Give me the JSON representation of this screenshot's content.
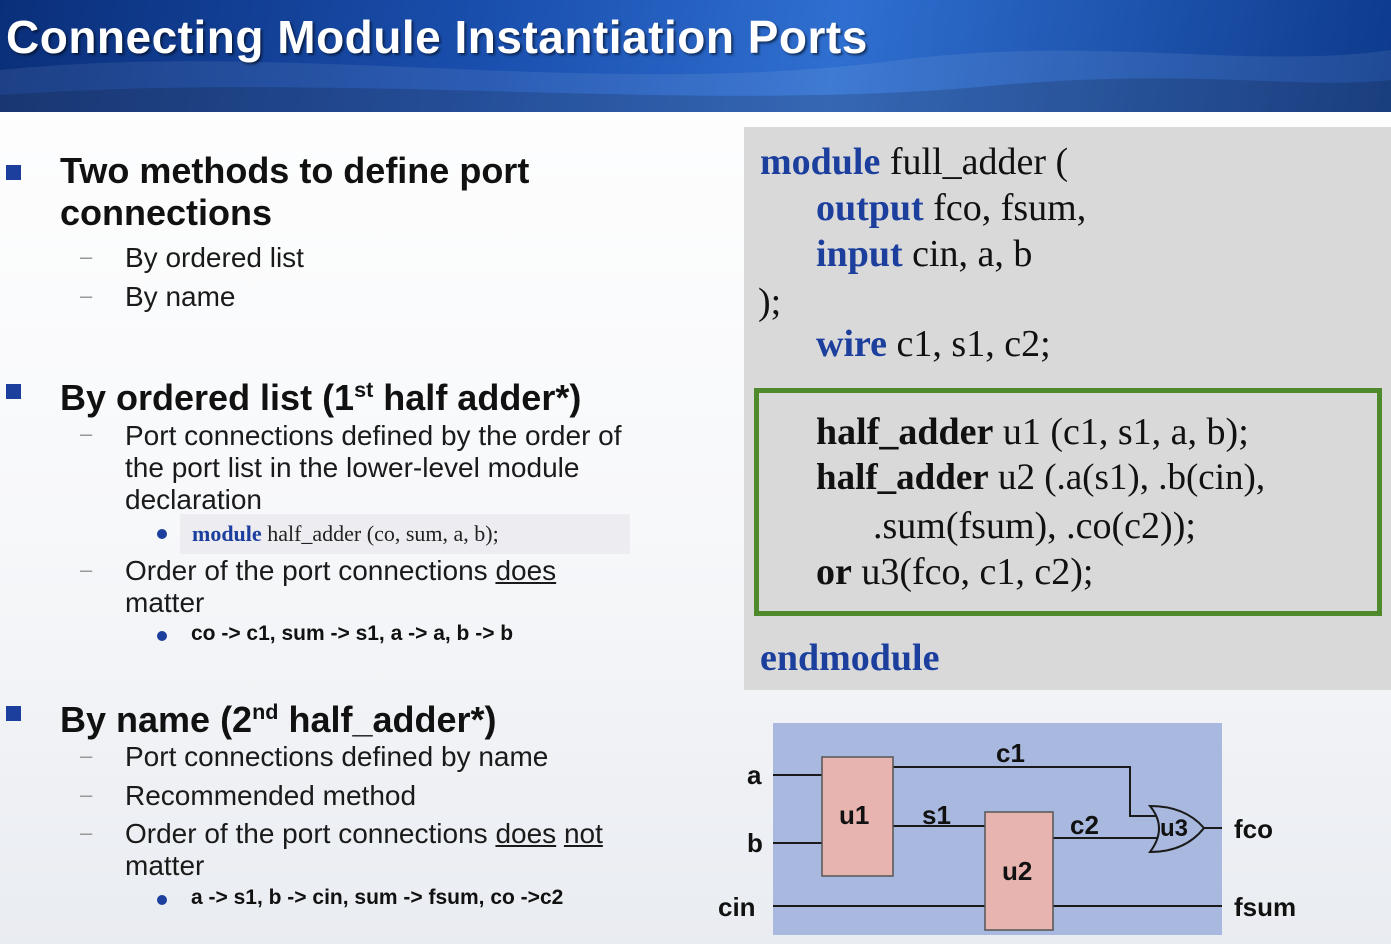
{
  "title": "Connecting Module Instantiation Ports",
  "left": {
    "section1": {
      "heading_line1": "Two methods to define port",
      "heading_line2": "connections",
      "items": [
        "By ordered list",
        "By name"
      ]
    },
    "section2": {
      "heading_pre": "By ordered list (1",
      "heading_sup": "st",
      "heading_post": " half adder*)",
      "item1_line1": "Port connections defined by the order of",
      "item1_line2": "the port list in the lower-level module",
      "item1_line3": "declaration",
      "decl_kw": "module",
      "decl_rest": " half_adder (co, sum, a, b);",
      "item2_pre": "Order of the port connections ",
      "item2_u": "does",
      "item2_line2": "matter",
      "mapping": "co -> c1, sum -> s1, a -> a, b -> b"
    },
    "section3": {
      "heading_pre": "By name (2",
      "heading_sup": "nd",
      "heading_post": " half_adder*)",
      "items": [
        "Port connections defined by name",
        "Recommended method"
      ],
      "item3_pre": "Order of the port connections ",
      "item3_u1": "does",
      "item3_u2": "not",
      "item3_line2": "matter",
      "mapping": "a -> s1, b -> cin, sum -> fsum, co ->c2"
    }
  },
  "code": {
    "l1_kw": "module",
    "l1_rest": " full_adder (",
    "l2_kw": "output",
    "l2_rest": " fco, fsum,",
    "l3_kw": "input",
    "l3_rest": " cin, a, b",
    "l4": ");",
    "l5_kw": "wire",
    "l5_rest": " c1, s1, c2;",
    "i1_kw": "half_adder",
    "i1_rest": " u1 (c1, s1, a, b);",
    "i2_kw": "half_adder",
    "i2_rest": " u2 (.a(s1),  .b(cin),",
    "i3": ".sum(fsum), .co(c2));",
    "i4_kw": "or",
    "i4_rest": "  u3(fco, c1, c2);",
    "end": "endmodule"
  },
  "diagram": {
    "inputs": [
      "a",
      "b",
      "cin"
    ],
    "blocks": [
      "u1",
      "u2",
      "u3"
    ],
    "wires": [
      "c1",
      "s1",
      "c2"
    ],
    "outputs": [
      "fco",
      "fsum"
    ],
    "colors": {
      "block_fill": "#e8b4b0",
      "background": "#a8b8de",
      "accent": "#1c3f9e",
      "box_border": "#4e8a2c"
    }
  }
}
